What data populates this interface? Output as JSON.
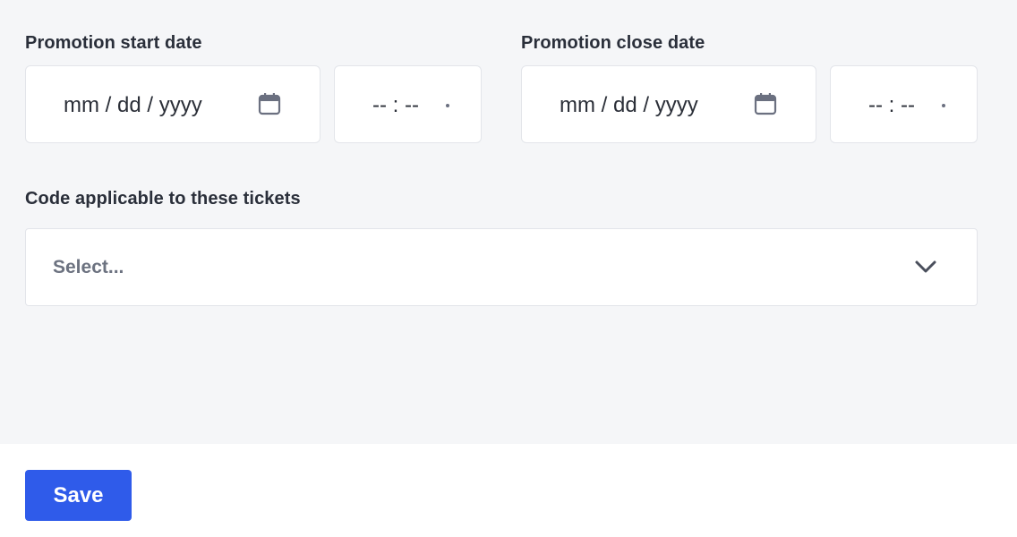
{
  "start": {
    "label": "Promotion start date",
    "date_placeholder": "mm / dd / yyyy",
    "time_placeholder": "-- : --"
  },
  "close": {
    "label": "Promotion close date",
    "date_placeholder": "mm / dd / yyyy",
    "time_placeholder": "-- : --"
  },
  "tickets": {
    "label": "Code applicable to these tickets",
    "placeholder": "Select..."
  },
  "footer": {
    "save_label": "Save"
  },
  "colors": {
    "accent": "#2f5bea",
    "background": "#f5f6f8",
    "text": "#2a2f3a",
    "muted": "#6c7280"
  },
  "icons": [
    "calendar-icon",
    "chevron-down-icon"
  ]
}
